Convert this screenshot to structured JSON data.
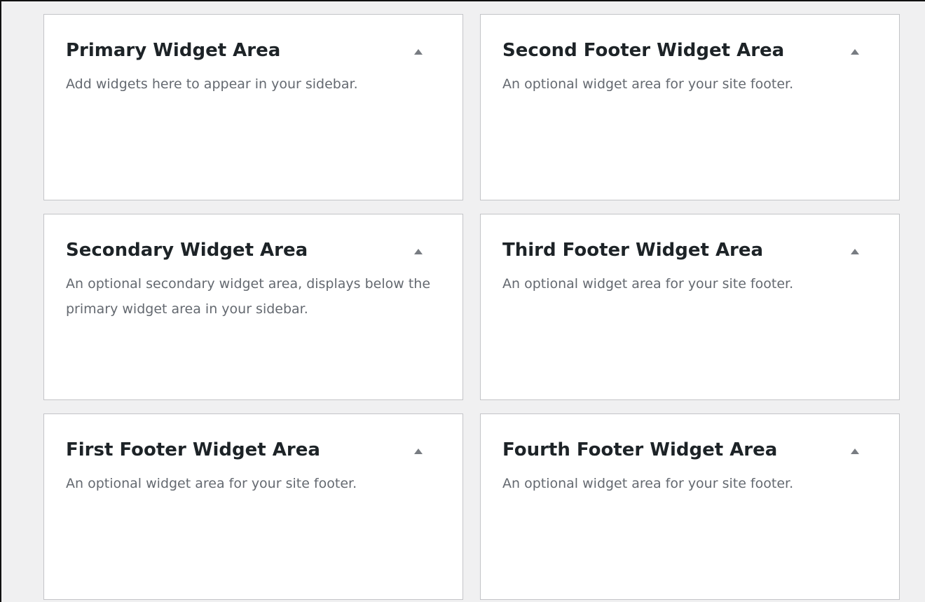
{
  "widget_areas": [
    {
      "title": "Primary Widget Area",
      "description": "Add widgets here to appear in your sidebar.",
      "toggle_icon": "arrow-up-icon"
    },
    {
      "title": "Second Footer Widget Area",
      "description": "An optional widget area for your site footer.",
      "toggle_icon": "arrow-up-icon"
    },
    {
      "title": "Secondary Widget Area",
      "description": "An optional secondary widget area, displays below the primary widget area in your sidebar.",
      "toggle_icon": "arrow-up-icon"
    },
    {
      "title": "Third Footer Widget Area",
      "description": "An optional widget area for your site footer.",
      "toggle_icon": "arrow-up-icon"
    },
    {
      "title": "First Footer Widget Area",
      "description": "An optional widget area for your site footer.",
      "toggle_icon": "arrow-up-icon"
    },
    {
      "title": "Fourth Footer Widget Area",
      "description": "An optional widget area for your site footer.",
      "toggle_icon": "arrow-up-icon"
    }
  ],
  "colors": {
    "page_background": "#f0f0f1",
    "panel_background": "#ffffff",
    "panel_border": "#c3c4c7",
    "title_text": "#1d2327",
    "description_text": "#646970",
    "arrow": "#787c82"
  }
}
